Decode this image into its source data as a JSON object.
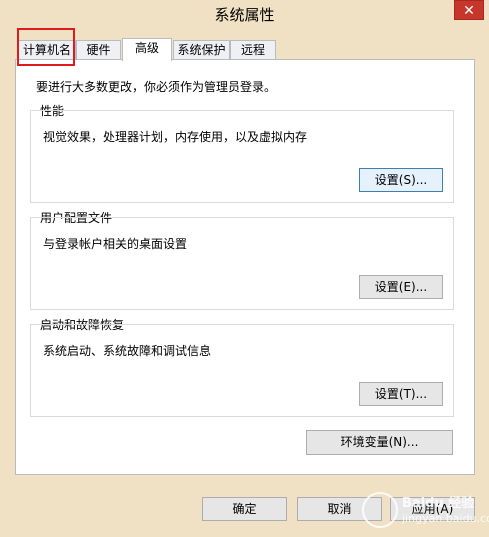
{
  "window": {
    "title": "系统属性",
    "close_glyph": "✕"
  },
  "tabs": [
    {
      "label": "计算机名"
    },
    {
      "label": "硬件"
    },
    {
      "label": "高级"
    },
    {
      "label": "系统保护"
    },
    {
      "label": "远程"
    }
  ],
  "active_tab": "高级",
  "notice": "要进行大多数更改，你必须作为管理员登录。",
  "groups": {
    "performance": {
      "title": "性能",
      "description": "视觉效果，处理器计划，内存使用，以及虚拟内存",
      "button": "设置(S)..."
    },
    "user_profiles": {
      "title": "用户配置文件",
      "description": "与登录帐户相关的桌面设置",
      "button": "设置(E)..."
    },
    "startup_recovery": {
      "title": "启动和故障恢复",
      "description": "系统启动、系统故障和调试信息",
      "button": "设置(T)..."
    }
  },
  "env_button": "环境变量(N)...",
  "footer": {
    "ok": "确定",
    "cancel": "取消",
    "apply": "应用(A)"
  },
  "watermark": {
    "text": "Baidu 经验",
    "url": "jingyan.baidu.com"
  },
  "colors": {
    "frame": "#f0e1c4",
    "close_button": "#c7362a",
    "highlight_box": "#e01b1b"
  }
}
